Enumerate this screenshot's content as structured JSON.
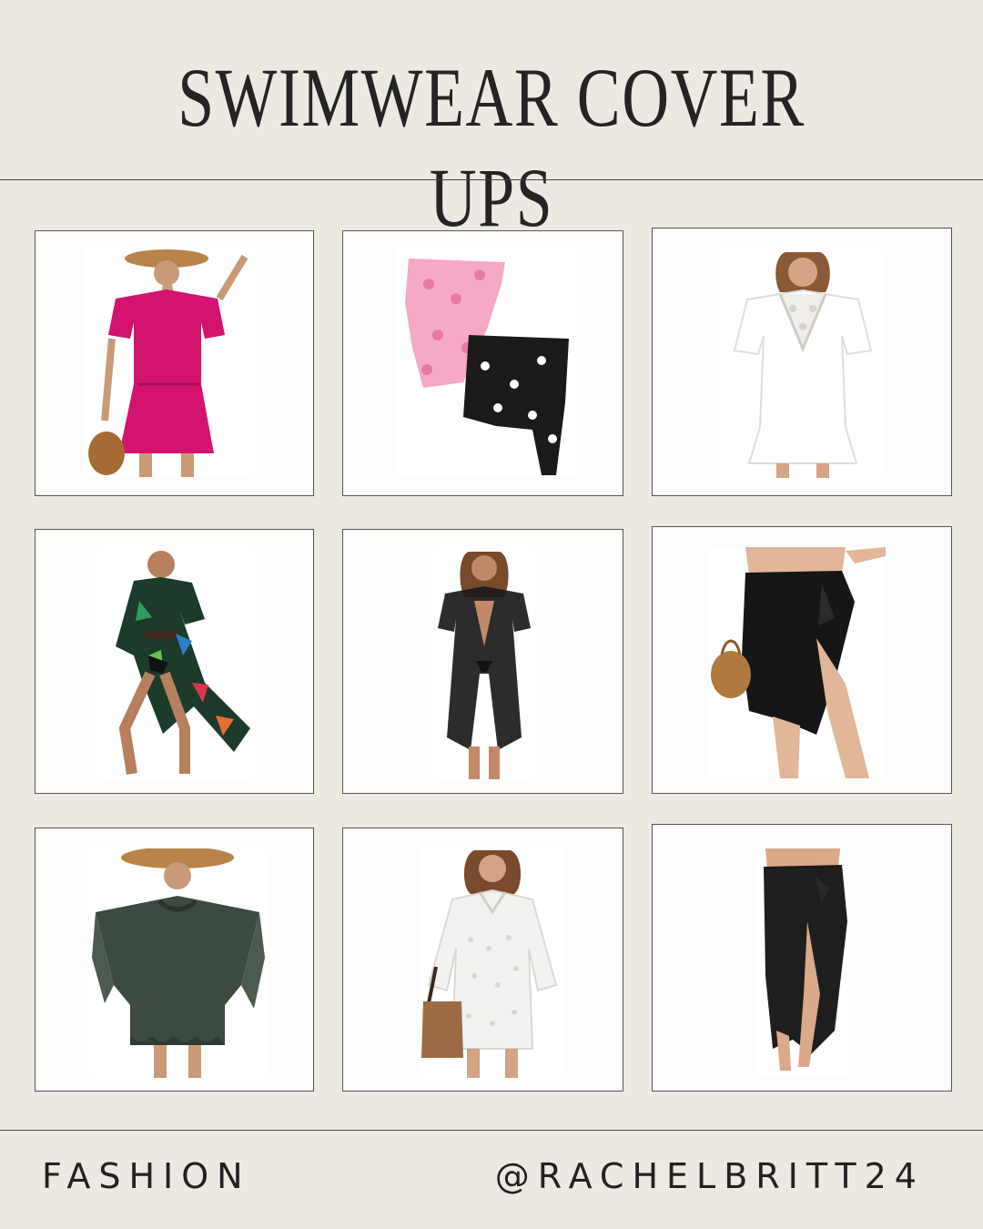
{
  "header": {
    "title": "SWIMWEAR COVER UPS"
  },
  "products": [
    {
      "icon": "pink-tshirt-dress-icon",
      "color": "#d4136f"
    },
    {
      "icon": "sarong-wraps-pink-black-icon",
      "color": "#f5a9c6"
    },
    {
      "icon": "white-crochet-tunic-icon",
      "color": "#ffffff"
    },
    {
      "icon": "tropical-kimono-icon",
      "color": "#1c3b2b"
    },
    {
      "icon": "black-sheer-kimono-icon",
      "color": "#1a1a1a"
    },
    {
      "icon": "black-short-sarong-icon",
      "color": "#161616"
    },
    {
      "icon": "dark-green-ruffle-caftan-icon",
      "color": "#3c4a40"
    },
    {
      "icon": "white-shirt-dress-icon",
      "color": "#f2f2f0"
    },
    {
      "icon": "black-long-sarong-icon",
      "color": "#121212"
    }
  ],
  "footer": {
    "category": "FASHION",
    "handle": "@RACHELBRITT24"
  }
}
